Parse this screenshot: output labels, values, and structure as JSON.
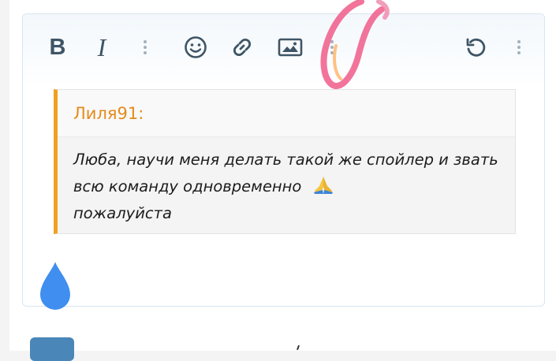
{
  "toolbar": {
    "bold_label": "B",
    "italic_label": "I",
    "buttons": [
      "bold",
      "italic",
      "more-options",
      "emoji",
      "link",
      "image",
      "more-insert",
      "undo",
      "more-actions"
    ]
  },
  "quote": {
    "author": "Лиля91:",
    "text": "Люба, научи меня делать такой же спойлер и звать всю команду одновременно",
    "text_end": "пожалуйста",
    "emoji": "folded-hands"
  },
  "colors": {
    "accent_orange": "#f0a020",
    "author_orange": "#e58b1b",
    "icon": "#3e5566",
    "drop_blue": "#3f8ef0",
    "scribble": "#f05c8a"
  }
}
